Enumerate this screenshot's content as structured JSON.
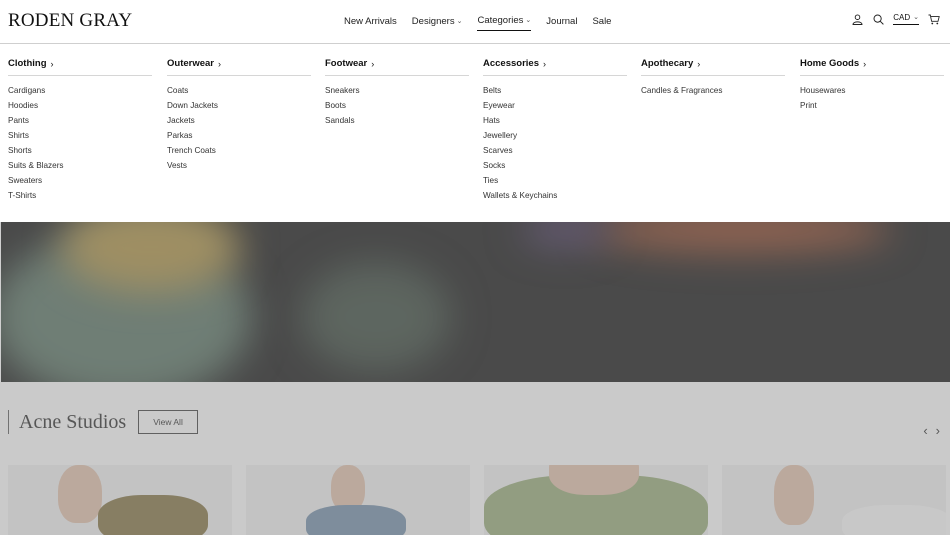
{
  "header": {
    "logo": "RODEN GRAY",
    "nav": [
      {
        "label": "New Arrivals",
        "has_caret": false,
        "active": false
      },
      {
        "label": "Designers",
        "has_caret": true,
        "active": false
      },
      {
        "label": "Categories",
        "has_caret": true,
        "active": true
      },
      {
        "label": "Journal",
        "has_caret": false,
        "active": false
      },
      {
        "label": "Sale",
        "has_caret": false,
        "active": false
      }
    ],
    "icons": [
      "account-icon",
      "search-icon",
      "cart-icon"
    ],
    "currency": "CAD"
  },
  "menu": {
    "columns": [
      {
        "title": "Clothing",
        "items": [
          "Cardigans",
          "Hoodies",
          "Pants",
          "Shirts",
          "Shorts",
          "Suits & Blazers",
          "Sweaters",
          "T-Shirts"
        ]
      },
      {
        "title": "Outerwear",
        "items": [
          "Coats",
          "Down Jackets",
          "Jackets",
          "Parkas",
          "Trench Coats",
          "Vests"
        ]
      },
      {
        "title": "Footwear",
        "items": [
          "Sneakers",
          "Boots",
          "Sandals"
        ]
      },
      {
        "title": "Accessories",
        "items": [
          "Belts",
          "Eyewear",
          "Hats",
          "Jewellery",
          "Scarves",
          "Socks",
          "Ties",
          "Wallets & Keychains"
        ]
      },
      {
        "title": "Apothecary",
        "items": [
          "Candles & Fragrances"
        ]
      },
      {
        "title": "Home Goods",
        "items": [
          "Housewares",
          "Print"
        ]
      }
    ]
  },
  "section": {
    "brand_title": "Acne Studios",
    "view_all": "View All"
  },
  "colors": {
    "text": "#111111",
    "divider": "#d6d6d6",
    "overlay": "#969696"
  }
}
